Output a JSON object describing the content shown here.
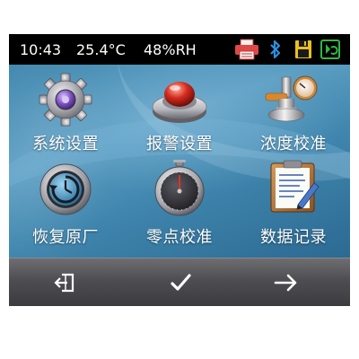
{
  "status": {
    "time": "10:43",
    "temperature": "25.4°C",
    "humidity": "48%RH",
    "icons": [
      "printer-icon",
      "bluetooth-icon",
      "save-disk-icon",
      "data-sync-icon"
    ]
  },
  "menu": {
    "items": [
      {
        "label": "系统设置",
        "icon": "gear-icon"
      },
      {
        "label": "报警设置",
        "icon": "alarm-button-icon"
      },
      {
        "label": "浓度校准",
        "icon": "gas-cylinder-gauge-icon"
      },
      {
        "label": "恢复原厂",
        "icon": "restore-icon"
      },
      {
        "label": "零点校准",
        "icon": "stopwatch-icon"
      },
      {
        "label": "数据记录",
        "icon": "clipboard-icon"
      }
    ]
  },
  "toolbar": {
    "buttons": [
      "exit-icon",
      "check-icon",
      "arrow-right-icon"
    ]
  },
  "colors": {
    "statusbar": "#000000",
    "content": "#4a90b8",
    "toolbar": "#4d4d52"
  }
}
